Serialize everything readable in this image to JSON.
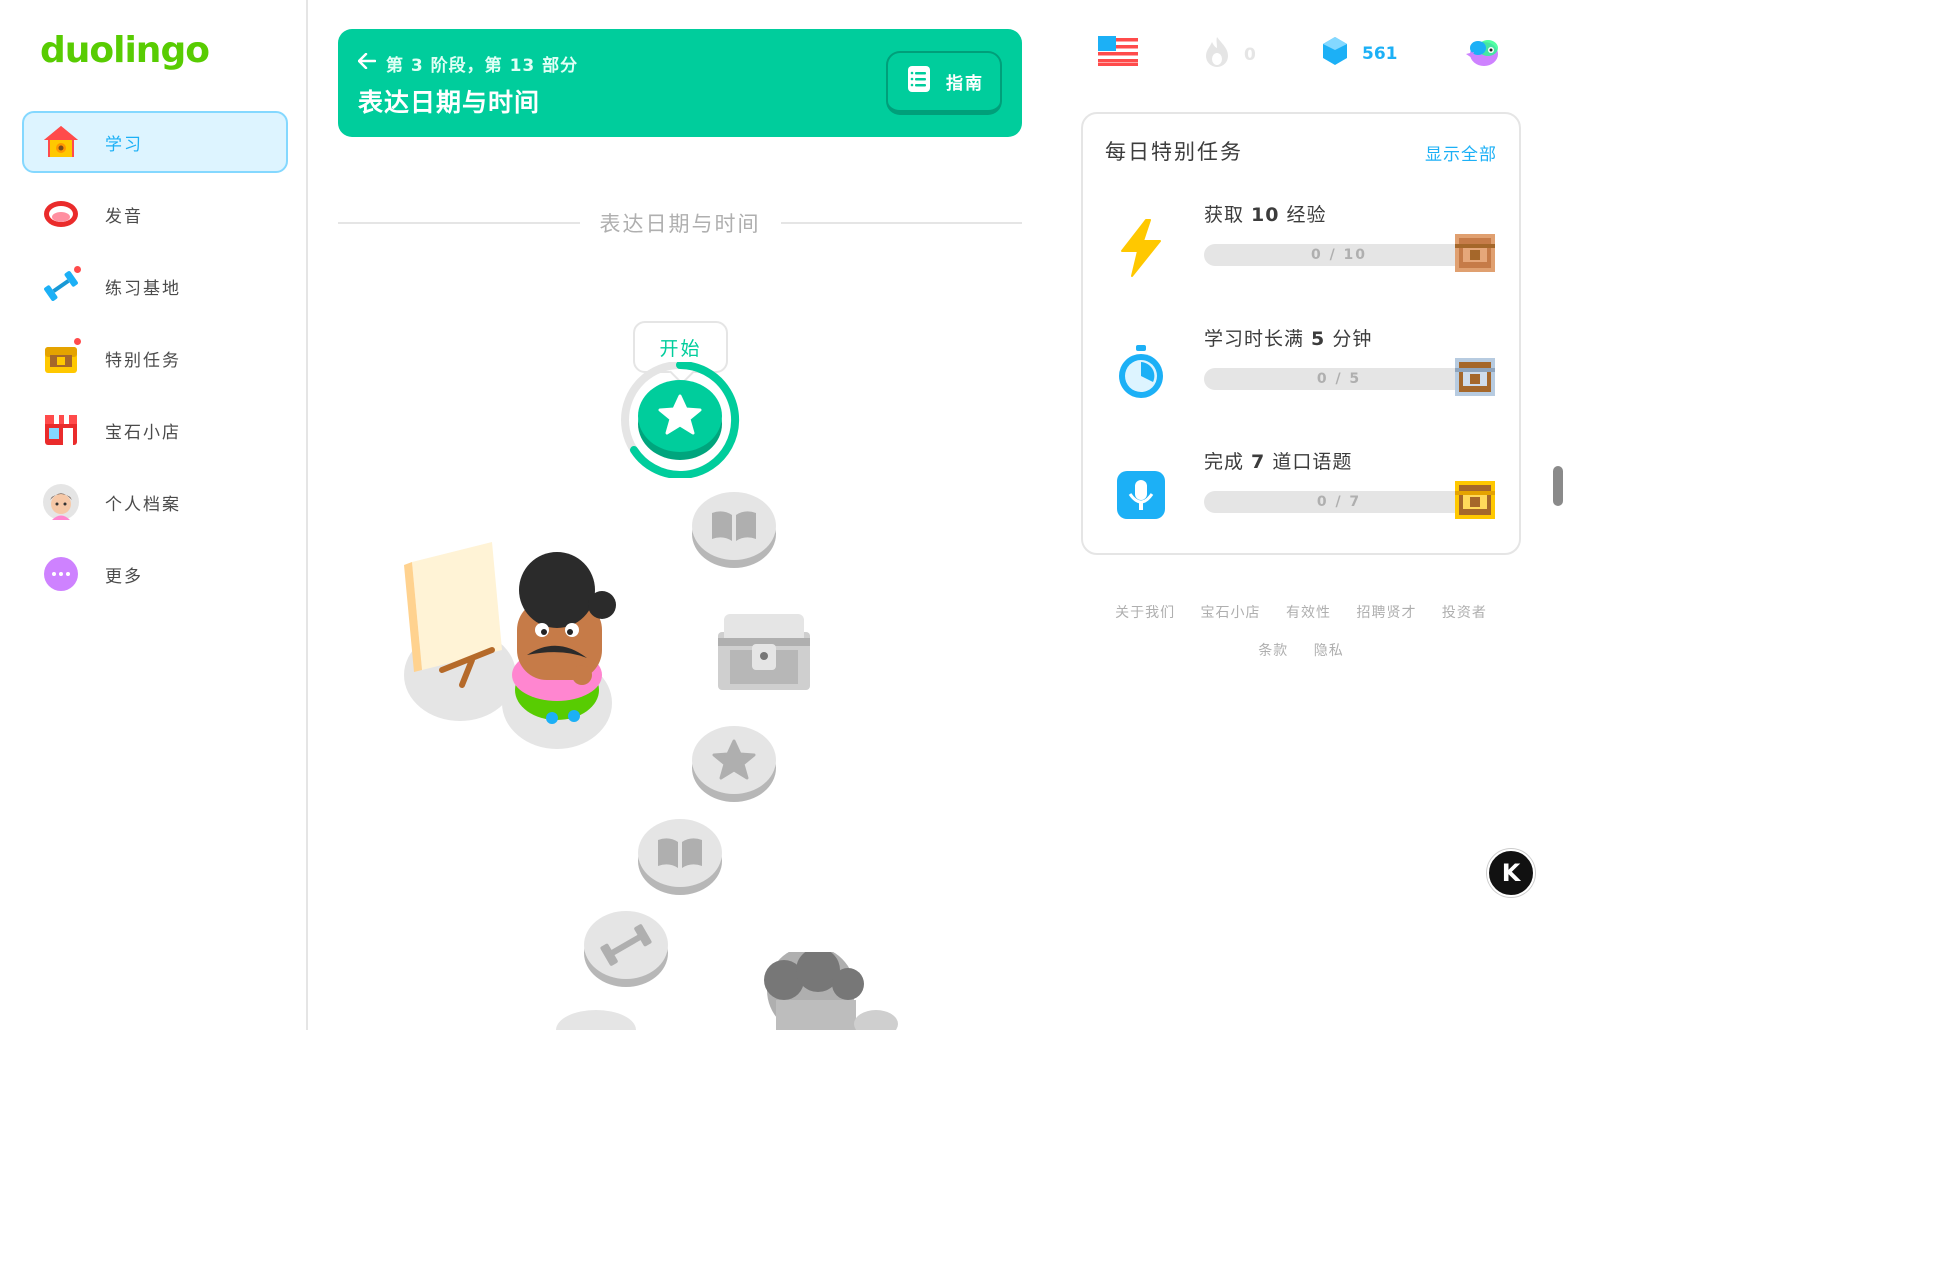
{
  "brand": {
    "logo_text": "duolingo",
    "accent": "#58cc02",
    "unit_color": "#00cd9c",
    "link_color": "#1cb0f6"
  },
  "sidebar": {
    "items": [
      {
        "label": "学习",
        "icon": "home-icon",
        "active": true
      },
      {
        "label": "发音",
        "icon": "mouth-icon",
        "active": false
      },
      {
        "label": "练习基地",
        "icon": "dumbbell-icon",
        "active": false
      },
      {
        "label": "特别任务",
        "icon": "treasure-chest-icon",
        "active": false
      },
      {
        "label": "宝石小店",
        "icon": "shop-icon",
        "active": false
      },
      {
        "label": "个人档案",
        "icon": "profile-avatar-icon",
        "active": false
      },
      {
        "label": "更多",
        "icon": "more-dots-icon",
        "active": false
      }
    ]
  },
  "unit": {
    "breadcrumb": "第 3 阶段，第 13 部分",
    "title": "表达日期与时间",
    "guide_label": "指南",
    "section_title": "表达日期与时间",
    "start_label": "开始",
    "nodes": [
      {
        "type": "star-lesson",
        "state": "current"
      },
      {
        "type": "story-book",
        "state": "locked"
      },
      {
        "type": "treasure-chest",
        "state": "locked"
      },
      {
        "type": "star-lesson",
        "state": "locked"
      },
      {
        "type": "story-book",
        "state": "locked"
      },
      {
        "type": "practice-dumbbell",
        "state": "locked"
      }
    ]
  },
  "stats": {
    "language_flag": "us-flag-icon",
    "streak": "0",
    "gems": "561",
    "super_icon": "super-duo-icon"
  },
  "quests": {
    "heading": "每日特别任务",
    "show_all": "显示全部",
    "items": [
      {
        "pre": "获取 ",
        "num": "10",
        "post": " 经验",
        "progress": "0 / 10",
        "progress_fraction": 0,
        "icon": "lightning-icon"
      },
      {
        "pre": "学习时长满 ",
        "num": "5",
        "post": " 分钟",
        "progress": "0 / 5",
        "progress_fraction": 0,
        "icon": "stopwatch-icon"
      },
      {
        "pre": "完成 ",
        "num": "7",
        "post": " 道口语题",
        "progress": "0 / 7",
        "progress_fraction": 0,
        "icon": "microphone-icon"
      }
    ]
  },
  "footer": {
    "row1": [
      "关于我们",
      "宝石小店",
      "有效性",
      "招聘贤才",
      "投资者"
    ],
    "row2": [
      "条款",
      "隐私"
    ]
  },
  "floating_badge": "K"
}
